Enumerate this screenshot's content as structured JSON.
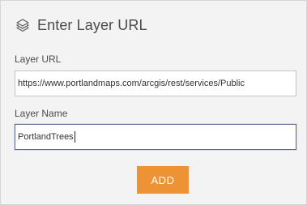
{
  "dialog": {
    "title": "Enter Layer URL",
    "title_icon": "layers-icon"
  },
  "layer_url": {
    "label": "Layer URL",
    "value": "https://www.portlandmaps.com/arcgis/rest/services/Public"
  },
  "layer_name": {
    "label": "Layer Name",
    "value": "PortlandTrees"
  },
  "actions": {
    "add_label": "ADD"
  },
  "colors": {
    "accent": "#ee9335",
    "panel_background": "#f3f3f3",
    "focused_border": "#5a6d8f"
  }
}
